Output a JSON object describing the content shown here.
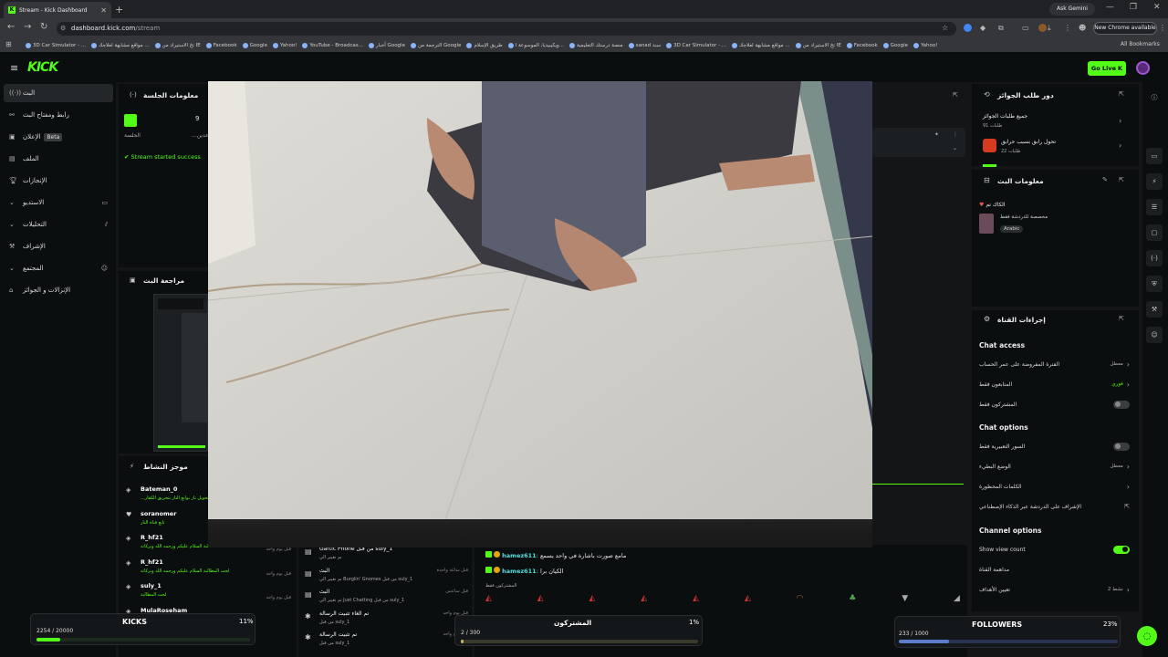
{
  "browser": {
    "tab_title": "Stream - Kick Dashboard",
    "url_host": "dashboard.kick.com",
    "url_path": "/stream",
    "ask_gemini": "Ask Gemini",
    "update_button": "New Chrome available",
    "all_bookmarks": "All Bookmarks",
    "bookmarks": [
      "3D Car Simulator - ...",
      "مواقع مشابهة لعلاجك ...",
      "تخ الاستيراد من IE",
      "Facebook",
      "Google",
      "Yahoo!",
      "YouTube - Broadcas...",
      "أخبار Google",
      "الترجمة من Google",
      "طريق الإسلام",
      "ويكيبيديا، الموسوعة ا...",
      "منصة درستك التعليمية",
      "sanad سند",
      "3D Car Simulator - ...",
      "مواقع مشابهة لعلاجك ...",
      "تخ الاستيراد من IE",
      "Facebook",
      "Google",
      "Yahoo!"
    ]
  },
  "topbar": {
    "logo": "KICK",
    "go_live": "Go Live"
  },
  "sidebar": {
    "items": [
      {
        "label": "البث"
      },
      {
        "label": "رابط ومفتاح البث"
      },
      {
        "label": "الإعلان",
        "badge": "Beta"
      },
      {
        "label": "الملف"
      },
      {
        "label": "الإنجازات"
      },
      {
        "label": "الاستديو"
      },
      {
        "label": "التحليلات"
      },
      {
        "label": "الإشراف"
      },
      {
        "label": "المجتمع"
      },
      {
        "label": "الإنزالات و الجوائز"
      }
    ]
  },
  "session": {
    "title": "معلومات الجلسة",
    "stat1_value": "",
    "stat1_label": "الجلسة",
    "stat2_value": "9",
    "stat2_label": "...عدين",
    "status": "Stream started success"
  },
  "preview": {
    "title": "مراجعة البث"
  },
  "activity": {
    "title": "موجز النشاط",
    "items": [
      {
        "name": "Bateman_0",
        "sub": "...تحويل نار بوابع النار بتحريق الكفار",
        "time": ""
      },
      {
        "name": "soranomer",
        "sub": "تابع قناة النار",
        "time": ""
      },
      {
        "name": "R_hf21",
        "sub": "لحت المطالبة السلام عليكم ورحمه الله وبركاته",
        "time": "قبل يوم واحد"
      },
      {
        "name": "R_hf21",
        "sub": "لحت المطالبة السلام عليكم ورحمه الله وبركاته",
        "time": "قبل يوم واحد"
      },
      {
        "name": "suly_1",
        "sub": "لحت المطالبة",
        "time": "قبل يوم واحد"
      },
      {
        "name": "MulaRoseham",
        "sub": "",
        "time": ""
      }
    ]
  },
  "mid_feed": {
    "items": [
      {
        "t1": "Gartic Phone من قبل suly_1",
        "t2": "تم تغيير الي",
        "time": ""
      },
      {
        "t1": "البث",
        "t2": "تم تغيير الي Burglin' Gnomes من قبل suly_1",
        "time": "قبل ساعة واحدة"
      },
      {
        "t1": "البث",
        "t2": "تم تغيير الي Just Chatting من قبل suly_1",
        "time": "قبل ساعتين"
      },
      {
        "t1": "تم الغاء تثبيت الرسالة",
        "t2": "من قبل suly_1",
        "time": "قبل يوم واحد"
      },
      {
        "t1": "تم تثبيت الرسالة",
        "t2": "من قبل suly_1",
        "time": "قبل يوم واحد"
      }
    ]
  },
  "chat": {
    "messages": [
      {
        "user": "hamez611",
        "text": "مامع صورت باشارة في واحد يسمع"
      },
      {
        "user": "hamez611",
        "text": "الكيان برا"
      }
    ],
    "subscribers_label": "المشتركون فقط"
  },
  "rewards": {
    "title": "دور طلب الجوائز",
    "all_requests": "جميع طلبات الجوائز",
    "all_count": "91 طلبات",
    "item": "تحول رابق بسبب حرابق",
    "item_count": "22 طلبات"
  },
  "stream_info": {
    "title": "معلومات البث",
    "stream_title": "الكاك تم",
    "category": "مخصصة للدردشة فقط",
    "language": "Arabic"
  },
  "channel_actions": {
    "title": "إجراءات القناة",
    "chat_access": "Chat access",
    "access_rows": [
      {
        "label": "الفترة المفروضة على عمر الحساب",
        "value": "معطل",
        "type": "chevron"
      },
      {
        "label": "المتابعون فقط",
        "value": "فوري",
        "type": "chevron"
      },
      {
        "label": "المشتركون فقط",
        "value": "",
        "type": "toggle",
        "on": false
      }
    ],
    "chat_options": "Chat options",
    "option_rows": [
      {
        "label": "السور التعبيرية فقط",
        "value": "",
        "type": "toggle",
        "on": false
      },
      {
        "label": "الوضع البطيء",
        "value": "معطل",
        "type": "chevron"
      },
      {
        "label": "الكلمات المحظورة",
        "value": "",
        "type": "chevron"
      },
      {
        "label": "الإشراف على الدردشة عبر الذكاء الإصطناعي",
        "value": "",
        "type": "external"
      }
    ],
    "channel_options": "Channel options",
    "channel_rows": [
      {
        "label": "Show view count",
        "value": "",
        "type": "toggle",
        "on": true
      },
      {
        "label": "مداهمة القناة",
        "value": "",
        "type": "none"
      },
      {
        "label": "تعيين الأهداف",
        "value": "نشط 2",
        "type": "chevron"
      }
    ]
  },
  "goals": {
    "kicks": {
      "label": "KICKS",
      "percent": "11%",
      "count": "2254 / 20000",
      "fraction": 0.11
    },
    "subs": {
      "label": "المشتركون",
      "percent": "1%",
      "count": "2 / 300",
      "fraction": 0.01
    },
    "followers": {
      "label": "FOLLOWERS",
      "percent": "23%",
      "count": "233 / 1000",
      "fraction": 0.23
    }
  },
  "colors": {
    "accent": "#53fc18",
    "bg": "#0b0e0f",
    "panel": "#141517"
  }
}
